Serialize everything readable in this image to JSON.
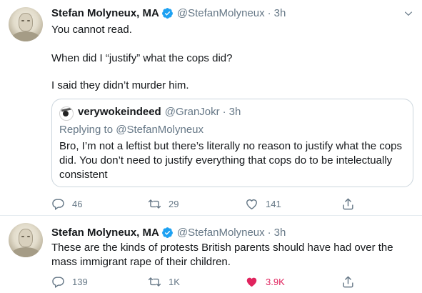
{
  "tweets": [
    {
      "name": "Stefan Molyneux, MA",
      "handle": "@StefanMolyneux",
      "separator": "·",
      "time": "3h",
      "lines": [
        "You cannot read.",
        "When did I “justify” what the cops did?",
        "I said they didn’t murder him."
      ],
      "quote": {
        "name": "verywokeindeed",
        "handle": "@GranJokr",
        "separator": "·",
        "time": "3h",
        "replying": "Replying to @StefanMolyneux",
        "text": "Bro, I’m not a leftist but there’s literally no reason to justify what the cops did. You don’t need to justify everything that cops do to be intelectually consistent"
      },
      "actions": {
        "replies": "46",
        "retweets": "29",
        "likes": "141",
        "liked": false
      }
    },
    {
      "name": "Stefan Molyneux, MA",
      "handle": "@StefanMolyneux",
      "separator": "·",
      "time": "3h",
      "lines": [
        "These are the kinds of protests British parents should have had over the",
        "mass immigrant rape of their children."
      ],
      "actions": {
        "replies": "139",
        "retweets": "1K",
        "likes": "3.9K",
        "liked": true
      }
    }
  ],
  "icons": {
    "verified": "verified-badge-icon",
    "caret": "chevron-down-icon",
    "reply": "reply-icon",
    "retweet": "retweet-icon",
    "like": "heart-icon",
    "share": "share-icon"
  },
  "colors": {
    "text": "#14171a",
    "secondary": "#657786",
    "verified": "#1da1f2",
    "like": "#e0245e",
    "border": "#e6ecf0"
  }
}
